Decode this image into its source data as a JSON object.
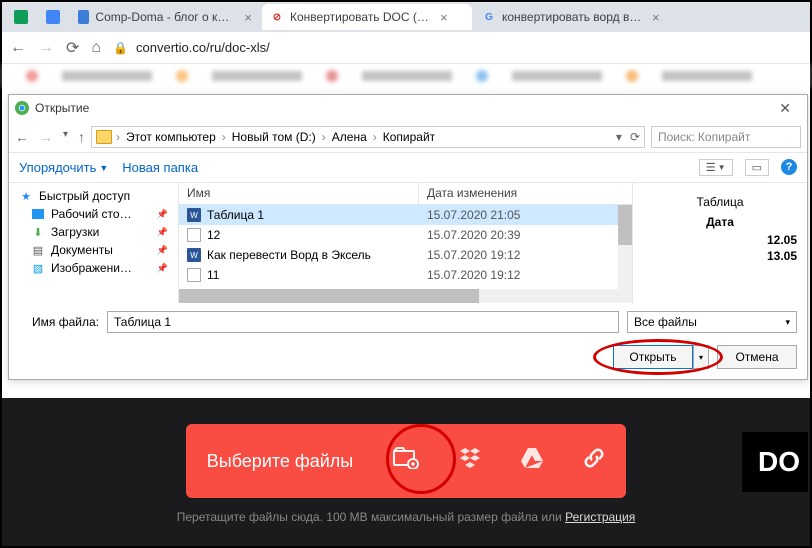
{
  "tabs": [
    {
      "title": "",
      "icon_bg": "#0f9d58"
    },
    {
      "title": "",
      "icon_bg": "#4285f4"
    },
    {
      "title": "Comp-Doma - блог о компьюте"
    },
    {
      "title": "Конвертировать DOC (WORD) в",
      "active": true
    },
    {
      "title": "конвертировать ворд в эксель"
    }
  ],
  "address": {
    "url": "convertio.co/ru/doc-xls/"
  },
  "dialog": {
    "title": "Открытие",
    "breadcrumb": [
      "Этот компьютер",
      "Новый том (D:)",
      "Алена",
      "Копирайт"
    ],
    "search_placeholder": "Поиск: Копирайт",
    "organize": "Упорядочить",
    "new_folder": "Новая папка",
    "sidebar": [
      {
        "label": "Быстрый доступ",
        "icon": "star"
      },
      {
        "label": "Рабочий сто…",
        "icon": "desk",
        "pinned": true
      },
      {
        "label": "Загрузки",
        "icon": "down",
        "pinned": true
      },
      {
        "label": "Документы",
        "icon": "doc",
        "pinned": true
      },
      {
        "label": "Изображени…",
        "icon": "img",
        "pinned": true
      }
    ],
    "columns": {
      "name": "Имя",
      "date": "Дата изменения"
    },
    "files": [
      {
        "name": "Таблица 1",
        "date": "15.07.2020 21:05",
        "type": "word",
        "selected": true
      },
      {
        "name": "12",
        "date": "15.07.2020 20:39",
        "type": "txt"
      },
      {
        "name": "Как перевести Ворд в Эксель",
        "date": "15.07.2020 19:12",
        "type": "word"
      },
      {
        "name": "11",
        "date": "15.07.2020 19:12",
        "type": "txt"
      }
    ],
    "preview": {
      "title": "Таблица",
      "bold": "Дата",
      "rows": [
        "12.05",
        "13.05"
      ]
    },
    "filename_label": "Имя файла:",
    "filename_value": "Таблица 1",
    "filter": "Все файлы",
    "open_btn": "Открыть",
    "cancel_btn": "Отмена"
  },
  "site": {
    "select_label": "Выберите файлы",
    "caption_pre": "Перетащите файлы сюда. 100 MB максимальный размер файла или ",
    "caption_link": "Регистрация",
    "badge": "DO"
  }
}
